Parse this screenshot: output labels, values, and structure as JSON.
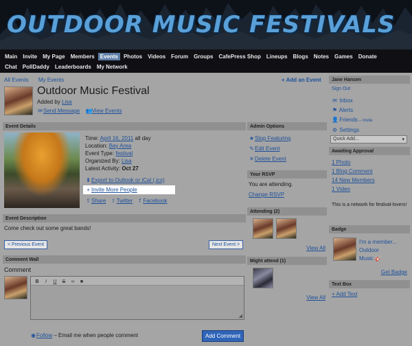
{
  "site": {
    "title": "OUTDOOR MUSIC FESTIVALS"
  },
  "nav": {
    "row1": [
      "Main",
      "Invite",
      "My Page",
      "Members",
      "Events",
      "Photos",
      "Videos",
      "Forum",
      "Groups",
      "CafePress Shop",
      "Lineups",
      "Blogs",
      "Notes",
      "Games",
      "Donate"
    ],
    "row2": [
      "Chat",
      "PollDaddy",
      "Leaderboards",
      "My Network"
    ],
    "active": "Events"
  },
  "subnav": {
    "all_events": "All Events",
    "my_events": "My Events",
    "add_event": "+ Add an Event"
  },
  "event": {
    "title": "Outdoor Music Festival",
    "added_by_label": "Added by",
    "added_by": "Lisa",
    "send_message": "Send Message",
    "view_events": "View Events",
    "details_header": "Event Details",
    "time_label": "Time:",
    "time_value": "April 16, 2011",
    "time_suffix": "all day",
    "location_label": "Location:",
    "location_value": "Bay Area",
    "type_label": "Event Type:",
    "type_value": "festival",
    "organized_label": "Organized By:",
    "organized_value": "Lisa",
    "latest_label": "Latest Activity:",
    "latest_value": "Oct 27",
    "export": "Export to Outlook or iCal (.ics)",
    "invite": "Invite More People",
    "share": "Share",
    "twitter": "Twitter",
    "facebook": "Facebook",
    "description_header": "Event Description",
    "description": "Come check out some great bands!",
    "prev": "< Previous Event",
    "next": "Next Event >"
  },
  "comments": {
    "header": "Comment Wall",
    "label": "Comment",
    "toolbar": [
      "B",
      "I",
      "U",
      "S",
      "∞",
      "■"
    ],
    "follow": "Follow",
    "follow_suffix": "– Email me when people comment",
    "submit": "Add Comment"
  },
  "admin": {
    "header": "Admin Options",
    "stop": "Stop Featuring",
    "edit": "Edit Event",
    "delete": "Delete Event"
  },
  "rsvp": {
    "header": "Your RSVP",
    "status": "You are attending.",
    "change": "Change RSVP"
  },
  "attending": {
    "header": "Attending (2)",
    "view_all": "View All"
  },
  "might": {
    "header": "Might attend (1)",
    "view_all": "View All"
  },
  "user": {
    "name": "Jane Hansen",
    "sign_out": "Sign Out",
    "inbox": "Inbox",
    "alerts": "Alerts",
    "friends": "Friends",
    "invite": "– Invite",
    "settings": "Settings",
    "quick_add": "Quick Add..."
  },
  "approval": {
    "header": "Awaiting Approval",
    "items": [
      "1 Photo",
      "1 Blog Comment",
      "14 New Members",
      "1 Video"
    ],
    "note": "This is a network for festival-lovers!"
  },
  "badge": {
    "header": "Badge",
    "line1": "I'm a member...",
    "line2": "Outdoor",
    "line3": "Music",
    "get": "Get Badge"
  },
  "textbox": {
    "header": "Text Box",
    "add": "+ Add Text"
  }
}
